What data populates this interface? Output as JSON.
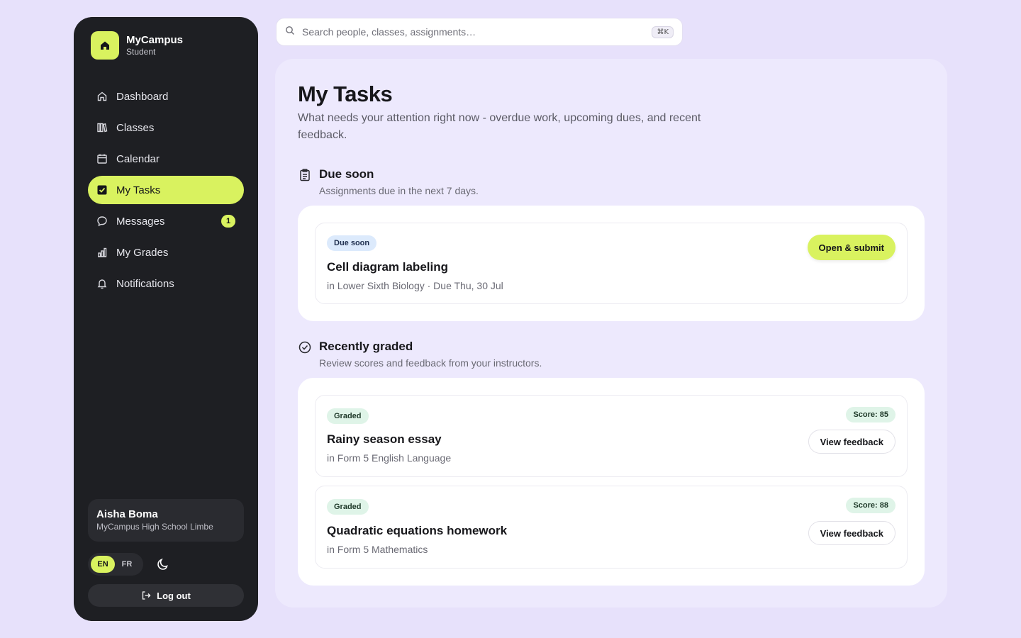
{
  "brand": {
    "name": "MyCampus",
    "role": "Student"
  },
  "nav": {
    "items": [
      {
        "label": "Dashboard",
        "icon": "home-icon"
      },
      {
        "label": "Classes",
        "icon": "books-icon"
      },
      {
        "label": "Calendar",
        "icon": "calendar-icon"
      },
      {
        "label": "My Tasks",
        "icon": "checkbox-icon",
        "active": true
      },
      {
        "label": "Messages",
        "icon": "message-icon",
        "badge": "1"
      },
      {
        "label": "My Grades",
        "icon": "bar-chart-icon"
      },
      {
        "label": "Notifications",
        "icon": "bell-icon"
      }
    ]
  },
  "user": {
    "name": "Aisha Boma",
    "school": "MyCampus High School Limbe"
  },
  "language": {
    "options": [
      "EN",
      "FR"
    ],
    "selected": "EN"
  },
  "logout_label": "Log out",
  "search": {
    "placeholder": "Search people, classes, assignments…",
    "shortcut": "⌘K"
  },
  "page": {
    "title": "My Tasks",
    "subtitle": "What needs your attention right now - overdue work, upcoming dues, and recent feedback."
  },
  "due_soon": {
    "title": "Due soon",
    "subtitle": "Assignments due in the next 7 days.",
    "items": [
      {
        "badge": "Due soon",
        "title": "Cell diagram labeling",
        "meta": "in Lower Sixth Biology · Due Thu, 30 Jul",
        "action": "Open & submit"
      }
    ]
  },
  "recently_graded": {
    "title": "Recently graded",
    "subtitle": "Review scores and feedback from your instructors.",
    "items": [
      {
        "badge": "Graded",
        "title": "Rainy season essay",
        "meta": "in Form 5 English Language",
        "score": "Score: 85",
        "action": "View feedback"
      },
      {
        "badge": "Graded",
        "title": "Quadratic equations homework",
        "meta": "in Form 5 Mathematics",
        "score": "Score: 88",
        "action": "View feedback"
      }
    ]
  },
  "colors": {
    "accent": "#d9f25f",
    "sidebar_bg": "#1e1f23",
    "page_bg": "#e7e1fb",
    "main_bg": "#ede9fd",
    "due_badge": "#dceafc",
    "graded_badge": "#dff4e8"
  }
}
